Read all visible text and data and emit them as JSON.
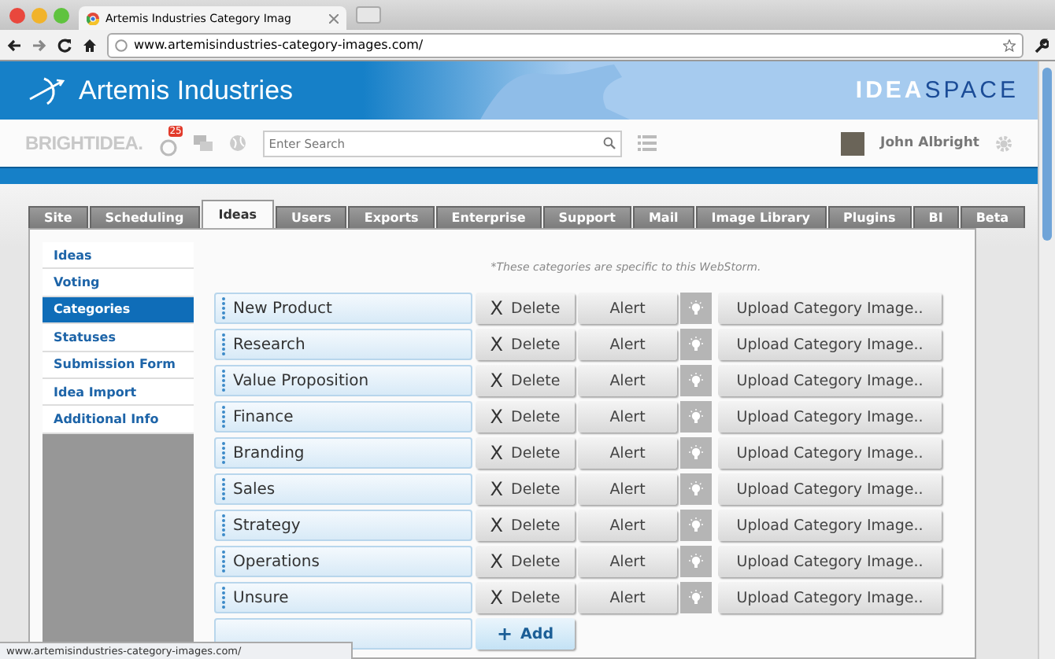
{
  "browser": {
    "tab_title": "Artemis Industries Category Imag",
    "url": "www.artemisindustries-category-images.com/"
  },
  "header": {
    "company": "Artemis Industries",
    "brand_left": "IDEA",
    "brand_right": "SPACE"
  },
  "toolbar": {
    "logo": "BRIGHTIDEA.",
    "badge": "25",
    "search_placeholder": "Enter Search",
    "user": "John Albright"
  },
  "tabs": [
    {
      "label": "Site",
      "selected": false
    },
    {
      "label": "Scheduling",
      "selected": false
    },
    {
      "label": "Ideas",
      "selected": true
    },
    {
      "label": "Users",
      "selected": false
    },
    {
      "label": "Exports",
      "selected": false
    },
    {
      "label": "Enterprise",
      "selected": false
    },
    {
      "label": "Support",
      "selected": false
    },
    {
      "label": "Mail",
      "selected": false
    },
    {
      "label": "Image Library",
      "selected": false
    },
    {
      "label": "Plugins",
      "selected": false
    },
    {
      "label": "BI",
      "selected": false
    },
    {
      "label": "Beta",
      "selected": false
    }
  ],
  "sidebar": {
    "items": [
      {
        "label": "Ideas",
        "selected": false
      },
      {
        "label": "Voting",
        "selected": false
      },
      {
        "label": "Categories",
        "selected": true
      },
      {
        "label": "Statuses",
        "selected": false
      },
      {
        "label": "Submission Form",
        "selected": false
      },
      {
        "label": "Idea Import",
        "selected": false
      },
      {
        "label": "Additional Info",
        "selected": false
      }
    ]
  },
  "note": "*These categories are specific to this WebStorm.",
  "categories": [
    {
      "name": "New Product",
      "delete_mark": "X",
      "delete": "Delete",
      "alert": "Alert",
      "upload": "Upload Category Image.."
    },
    {
      "name": "Research",
      "delete_mark": "X",
      "delete": "Delete",
      "alert": "Alert",
      "upload": "Upload Category Image.."
    },
    {
      "name": "Value Proposition",
      "delete_mark": "X",
      "delete": "Delete",
      "alert": "Alert",
      "upload": "Upload Category Image.."
    },
    {
      "name": "Finance",
      "delete_mark": "X",
      "delete": "Delete",
      "alert": "Alert",
      "upload": "Upload Category Image.."
    },
    {
      "name": "Branding",
      "delete_mark": "X",
      "delete": "Delete",
      "alert": "Alert",
      "upload": "Upload Category Image.."
    },
    {
      "name": "Sales",
      "delete_mark": "X",
      "delete": "Delete",
      "alert": "Alert",
      "upload": "Upload Category Image.."
    },
    {
      "name": "Strategy",
      "delete_mark": "X",
      "delete": "Delete",
      "alert": "Alert",
      "upload": "Upload Category Image.."
    },
    {
      "name": "Operations",
      "delete_mark": "X",
      "delete": "Delete",
      "alert": "Alert",
      "upload": "Upload Category Image.."
    },
    {
      "name": "Unsure",
      "delete_mark": "X",
      "delete": "Delete",
      "alert": "Alert",
      "upload": "Upload Category Image.."
    }
  ],
  "add": {
    "mark": "+",
    "label": "Add"
  },
  "status_bar": "www.artemisindustries-category-images.com/"
}
